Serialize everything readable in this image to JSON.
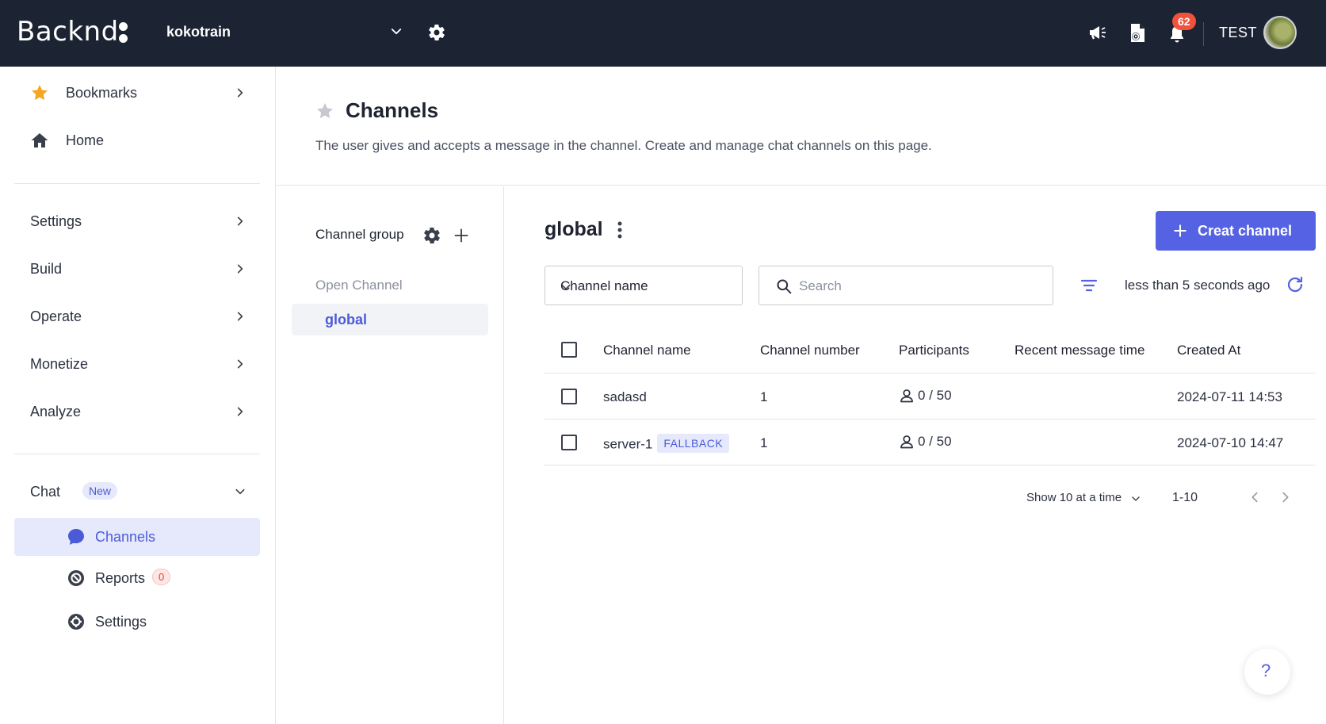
{
  "topbar": {
    "logo": "Backnd",
    "project_name": "kokotrain",
    "notification_count": "62",
    "user_name": "TEST"
  },
  "sidebar": {
    "bookmarks": "Bookmarks",
    "home": "Home",
    "items": [
      "Settings",
      "Build",
      "Operate",
      "Monetize",
      "Analyze"
    ],
    "chat": {
      "label": "Chat",
      "badge": "New"
    },
    "chat_items": {
      "channels": "Channels",
      "reports": "Reports",
      "reports_count": "0",
      "settings": "Settings"
    }
  },
  "page": {
    "title": "Channels",
    "description": "The user gives and accepts a message in the channel. Create and manage chat channels on this page."
  },
  "group_panel": {
    "title": "Channel group",
    "section": "Open Channel",
    "selected_group": "global"
  },
  "content": {
    "title": "global",
    "create_button": "Creat channel",
    "filter_select": "Channel name",
    "search_placeholder": "Search",
    "refresh_time": "less than 5 seconds ago",
    "columns": [
      "Channel name",
      "Channel number",
      "Participants",
      "Recent message time",
      "Created At"
    ],
    "rows": [
      {
        "name": "sadasd",
        "tag": "",
        "number": "1",
        "participants": "0 / 50",
        "recent": "",
        "created": "2024-07-11 14:53"
      },
      {
        "name": "server-1",
        "tag": "FALLBACK",
        "number": "1",
        "participants": "0 / 50",
        "recent": "",
        "created": "2024-07-10 14:47"
      }
    ],
    "pager": {
      "page_size": "Show 10 at a time",
      "range": "1-10"
    }
  },
  "help": "?",
  "colors": {
    "topbar": "#1c2333",
    "accent": "#5462e3",
    "active_bg": "#e6e9fb",
    "badge": "#f0523b"
  }
}
